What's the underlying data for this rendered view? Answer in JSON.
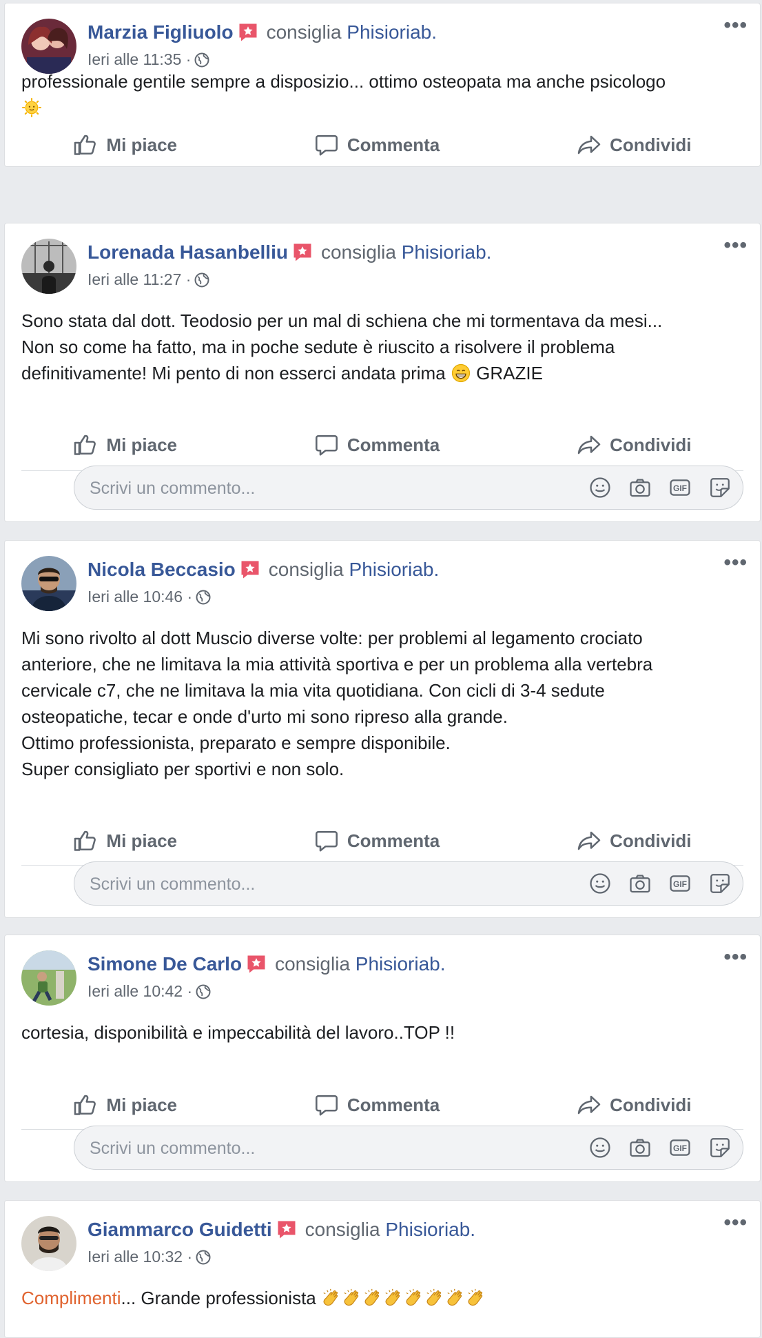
{
  "common": {
    "verb": "consiglia",
    "page_name": "Phisioriab.",
    "more": "•••",
    "like": "Mi piace",
    "comment": "Commenta",
    "share": "Condividi",
    "comment_placeholder": "Scrivi un commento...",
    "gif_label": "GIF",
    "colors": {
      "name_link": "#385898",
      "meta": "#606770",
      "highlight": "#e0632f",
      "badge": "#e9556a"
    }
  },
  "posts": [
    {
      "author": "Marzia Figliuolo",
      "time": "Ieri alle 11:35",
      "sep": "·",
      "text": "professionale gentile sempre a disposizio... ottimo osteopata ma anche psicologo",
      "emoji": "sun-face-icon"
    },
    {
      "author": "Lorenada Hasanbelliu",
      "time": "Ieri alle 11:27",
      "sep": "·",
      "text_before": "Sono stata dal dott. Teodosio per un mal di schiena che mi tormentava da mesi...\nNon so come ha fatto, ma in poche sedute è riuscito a risolvere il problema\ndefinitivamente! Mi pento di non esserci andata prima ",
      "text_after": " GRAZIE",
      "emoji": "grinning-face-icon"
    },
    {
      "author": "Nicola Beccasio",
      "time": "Ieri alle 10:46",
      "sep": "·",
      "text": "Mi sono rivolto al dott Muscio diverse volte: per problemi al legamento crociato\nanteriore, che ne limitava la mia attività sportiva e per un problema alla vertebra\ncervicale c7, che ne limitava la mia vita quotidiana. Con cicli di 3-4 sedute\nosteopatiche, tecar e onde d'urto mi sono ripreso alla grande.\nOttimo professionista, preparato e sempre disponibile.\nSuper consigliato per sportivi e non solo."
    },
    {
      "author": "Simone De Carlo",
      "time": "Ieri alle 10:42",
      "sep": "·",
      "text": "cortesia, disponibilità e impeccabilità del lavoro..TOP !!"
    },
    {
      "author": "Giammarco Guidetti",
      "time": "Ieri alle 10:32",
      "sep": "·",
      "text_highlight": "Complimenti",
      "text": "... Grande professionista ",
      "emoji": "clapping-hands-icon",
      "emoji_count": 8
    }
  ]
}
